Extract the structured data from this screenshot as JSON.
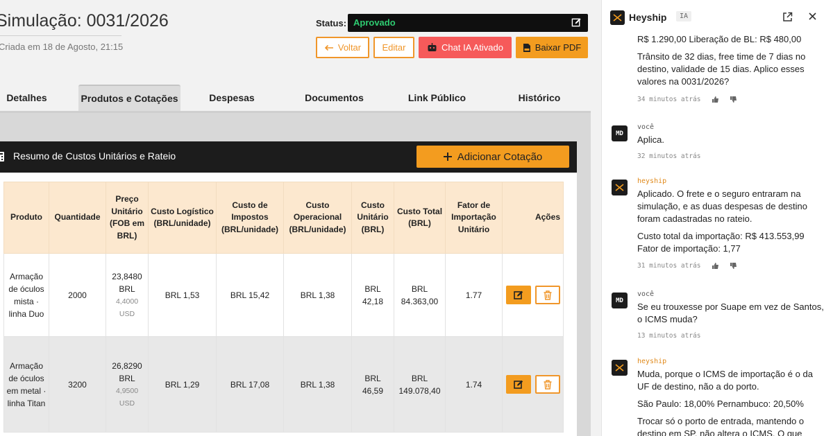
{
  "header": {
    "title": "Simulação: 0031/2026",
    "subtitle": "Criada em 18 de Agosto, 21:15",
    "status_label": "Status:",
    "status_value": "Aprovado"
  },
  "actions": {
    "back": "Voltar",
    "edit": "Editar",
    "chat": "Chat IA Ativado",
    "pdf": "Baixar PDF"
  },
  "tabs": [
    "Detalhes",
    "Produtos e Cotações",
    "Despesas",
    "Documentos",
    "Link Público",
    "Histórico"
  ],
  "active_tab": "Produtos e Cotações",
  "panel": {
    "title": "Resumo de Custos Unitários e Rateio",
    "add_button": "Adicionar Cotação"
  },
  "table": {
    "columns": [
      "Produto",
      "Quantidade",
      "Preço Unitário (FOB em BRL)",
      "Custo Logístico (BRL/unidade)",
      "Custo de Impostos (BRL/unidade)",
      "Custo Operacional (BRL/unidade)",
      "Custo Unitário (BRL)",
      "Custo Total (BRL)",
      "Fator de Importação Unitário",
      "Ações"
    ],
    "rows": [
      {
        "produto": "Armação de óculos mista · linha Duo",
        "quantidade": "2000",
        "preco_brl": "23,8480 BRL",
        "preco_usd": "4,4000 USD",
        "logistico": "BRL 1,53",
        "impostos": "BRL 15,42",
        "operacional": "BRL 1,38",
        "unitario": "BRL 42,18",
        "total": "BRL 84.363,00",
        "fator": "1.77"
      },
      {
        "produto": "Armação de óculos em metal · linha Titan",
        "quantidade": "3200",
        "preco_brl": "26,8290 BRL",
        "preco_usd": "4,9500 USD",
        "logistico": "BRL 1,29",
        "impostos": "BRL 17,08",
        "operacional": "BRL 1,38",
        "unitario": "BRL 46,59",
        "total": "BRL 149.078,40",
        "fator": "1.74"
      }
    ]
  },
  "chat": {
    "name": "Heyship",
    "badge": "IA",
    "messages": [
      {
        "author": "",
        "avatar": "",
        "paragraphs": [
          "R$ 1.290,00 Liberação de BL: R$ 480,00",
          "Trânsito de 32 dias, free time de 7 dias no destino, validade de 15 dias. Aplico esses valores na 0031/2026?"
        ],
        "time": "34 minutos atrás"
      },
      {
        "author": "você",
        "avatar": "MD",
        "paragraphs": [
          "Aplica."
        ],
        "time": "32 minutos atrás"
      },
      {
        "author": "heyship",
        "avatar": "",
        "paragraphs": [
          "Aplicado. O frete e o seguro entraram na simulação, e as duas despesas de destino foram cadastradas no rateio.",
          "Custo total da importação: R$ 413.553,99 Fator de importação: 1,77"
        ],
        "time": "31 minutos atrás"
      },
      {
        "author": "você",
        "avatar": "MD",
        "paragraphs": [
          "Se eu trouxesse por Suape em vez de Santos, o ICMS muda?"
        ],
        "time": "13 minutos atrás"
      },
      {
        "author": "heyship",
        "avatar": "",
        "paragraphs": [
          "Muda, porque o ICMS de importação é o da UF de destino, não a do porto.",
          "São Paulo: 18,00% Pernambuco: 20,50%",
          "Trocar só o porto de entrada, mantendo o destino em SP, não altera o ICMS. O que altera"
        ],
        "time": ""
      }
    ]
  },
  "colors": {
    "accent": "#f39c1f",
    "chat_button": "#f65a5a",
    "status_text": "#2ecc71",
    "header_bg": "#fce8cf"
  }
}
